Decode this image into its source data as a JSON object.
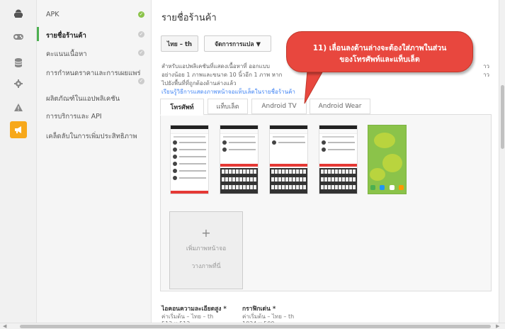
{
  "rail": {
    "icons": [
      "android-icon",
      "gamepad-icon",
      "database-icon",
      "settings-icon",
      "warning-icon",
      "megaphone-icon"
    ]
  },
  "sidebar": {
    "items": [
      {
        "label": "APK",
        "status": "done"
      },
      {
        "label": "รายชื่อร้านค้า",
        "status": "pending"
      },
      {
        "label": "คะแนนเนื้อหา",
        "status": "pending"
      },
      {
        "label": "การกำหนดราคาและการเผยแพร่",
        "status": "pending"
      },
      {
        "label": "ผลิตภัณฑ์ในแอปพลิเคชัน"
      },
      {
        "label": "การบริการและ API"
      },
      {
        "label": "เคล็ดลับในการเพิ่มประสิทธิภาพ"
      }
    ]
  },
  "main": {
    "title": "รายชื่อร้านค้า",
    "language_select": "ไทย – th",
    "translate_button": "จัดการการแปล ▼",
    "description": [
      "สำหรับแอปพลิเคชันที่แสดงเนื้อหาที่ ออกแบบ",
      "อย่างน้อย 1 ภาพและขนาด 10 นิ้วอีก 1 ภาพ หาก",
      "ไปยังพื้นที่ที่ถูกต้องด้านล่างแล้ว"
    ],
    "description_tail": [
      "าว",
      "าว"
    ],
    "help_link": "เรียนรู้วิธีการแสดงภาพหน้าจอแท็บเล็ตในรายชื่อร้านค้า",
    "tabs": [
      "โทรศัพท์",
      "แท็บเล็ต",
      "Android TV",
      "Android Wear"
    ],
    "add_screenshot": {
      "plus": "+",
      "label": "เพิ่มภาพหน้าจอ",
      "hint": "วางภาพที่นี่"
    },
    "fields": [
      {
        "title": "ไอคอนความละเอียดสูง *",
        "sub": "ค่าเริ่มต้น – ไทย – th",
        "sub2": "512 x 512"
      },
      {
        "title": "กราฟิกเด่น *",
        "sub": "ค่าเริ่มต้น – ไทย – th",
        "sub2": "1024 x 500"
      }
    ]
  },
  "callout": {
    "line1": "11) เลื่อนลงด้านล่างจะต้องใส่ภาพในส่วน",
    "line2": "ของโทรศัพท์และแท็บเล็ต"
  },
  "colors": {
    "accent_green": "#8bc34a",
    "callout_red": "#e8473e",
    "link_blue": "#4285f4",
    "rail_active": "#f7a81b"
  }
}
